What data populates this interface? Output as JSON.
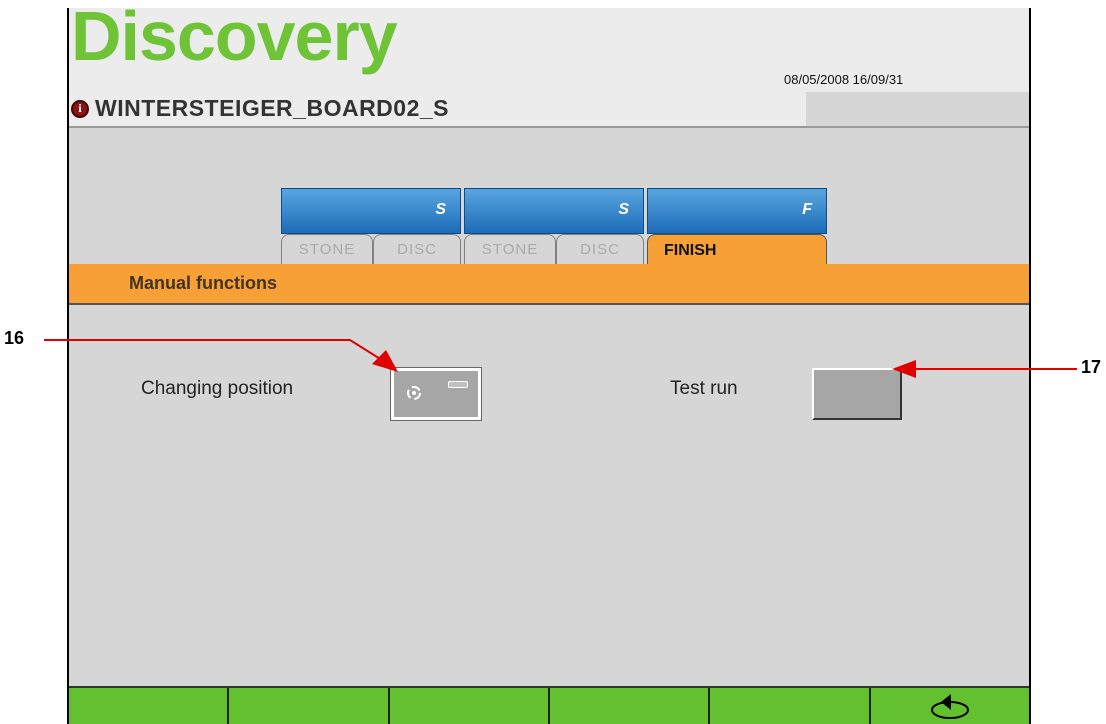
{
  "header": {
    "brand": "Discovery",
    "board_name": "WINTERSTEIGER_BOARD02_S",
    "datetime": "08/05/2008 16/09/31",
    "info_icon": "info-icon"
  },
  "tabs": [
    {
      "letter": "S",
      "subtabs": [
        "STONE",
        "DISC"
      ]
    },
    {
      "letter": "S",
      "subtabs": [
        "STONE",
        "DISC"
      ]
    },
    {
      "letter": "F",
      "active_label": "FINISH"
    }
  ],
  "section": {
    "title": "Manual functions"
  },
  "functions": {
    "changing_position": "Changing position",
    "test_run": "Test run"
  },
  "function_bar": {
    "keys": [
      "",
      "",
      "",
      "",
      "",
      ""
    ],
    "back_icon": "back-arrow-icon"
  },
  "callouts": {
    "left": "16",
    "right": "17"
  },
  "colors": {
    "brand": "#6ec436",
    "tab_blue": "#1c6cb8",
    "accent_orange": "#f7a035",
    "function_green": "#63c12f",
    "callout_red": "#e00000"
  }
}
